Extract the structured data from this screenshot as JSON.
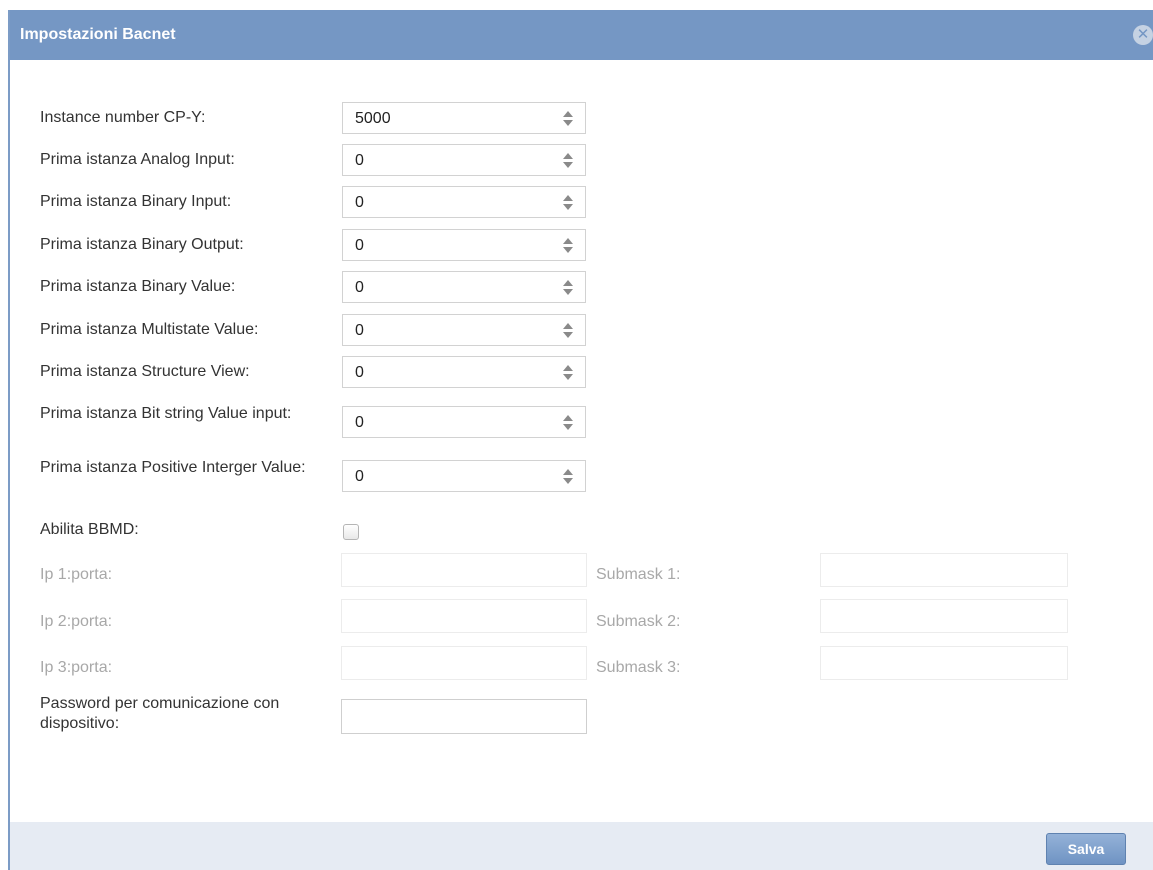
{
  "dialog": {
    "title": "Impostazioni Bacnet",
    "close_icon": "close-icon"
  },
  "fields": [
    {
      "label": "Instance number CP-Y:",
      "value": "5000"
    },
    {
      "label": "Prima istanza Analog Input:",
      "value": "0"
    },
    {
      "label": "Prima istanza Binary Input:",
      "value": "0"
    },
    {
      "label": "Prima istanza Binary Output:",
      "value": "0"
    },
    {
      "label": "Prima istanza Binary Value:",
      "value": "0"
    },
    {
      "label": "Prima istanza Multistate Value:",
      "value": "0"
    },
    {
      "label": "Prima istanza Structure View:",
      "value": "0"
    },
    {
      "label": "Prima istanza Bit string Value input:",
      "value": "0"
    },
    {
      "label": "Prima istanza Positive Interger Value:",
      "value": "0"
    }
  ],
  "bbmd": {
    "label": "Abilita BBMD:",
    "checked": false,
    "entries": [
      {
        "ip_label": "Ip 1:porta:",
        "ip_value": "",
        "mask_label": "Submask 1:",
        "mask_value": ""
      },
      {
        "ip_label": "Ip 2:porta:",
        "ip_value": "",
        "mask_label": "Submask 2:",
        "mask_value": ""
      },
      {
        "ip_label": "Ip 3:porta:",
        "ip_value": "",
        "mask_label": "Submask 3:",
        "mask_value": ""
      }
    ]
  },
  "password": {
    "label": "Password per comunicazione con dispositivo:",
    "value": ""
  },
  "footer": {
    "save_label": "Salva"
  },
  "colors": {
    "titlebar": "#7597c4",
    "footer": "#e6ebf3",
    "disabled_text": "#a8a8a8"
  }
}
